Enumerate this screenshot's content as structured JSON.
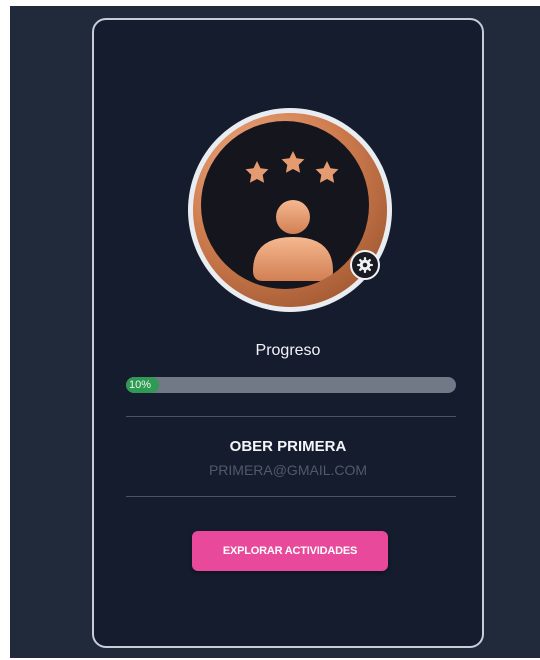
{
  "profile": {
    "progress_title": "Progreso",
    "progress_value": 0.1,
    "progress_label": "10%",
    "name": "OBER PRIMERA",
    "email": "PRIMERA@GMAIL.COM",
    "settings_icon": "gear-icon",
    "avatar_icon": "user-icon",
    "stars_icon": "star-icon",
    "cta_label": "EXPLORAR ACTIVIDADES"
  },
  "colors": {
    "background": "#212a3a",
    "card": "#141c2e",
    "accent": "#e8499b",
    "progress": "#2f9a54",
    "bronze": "#cf7d4f"
  }
}
